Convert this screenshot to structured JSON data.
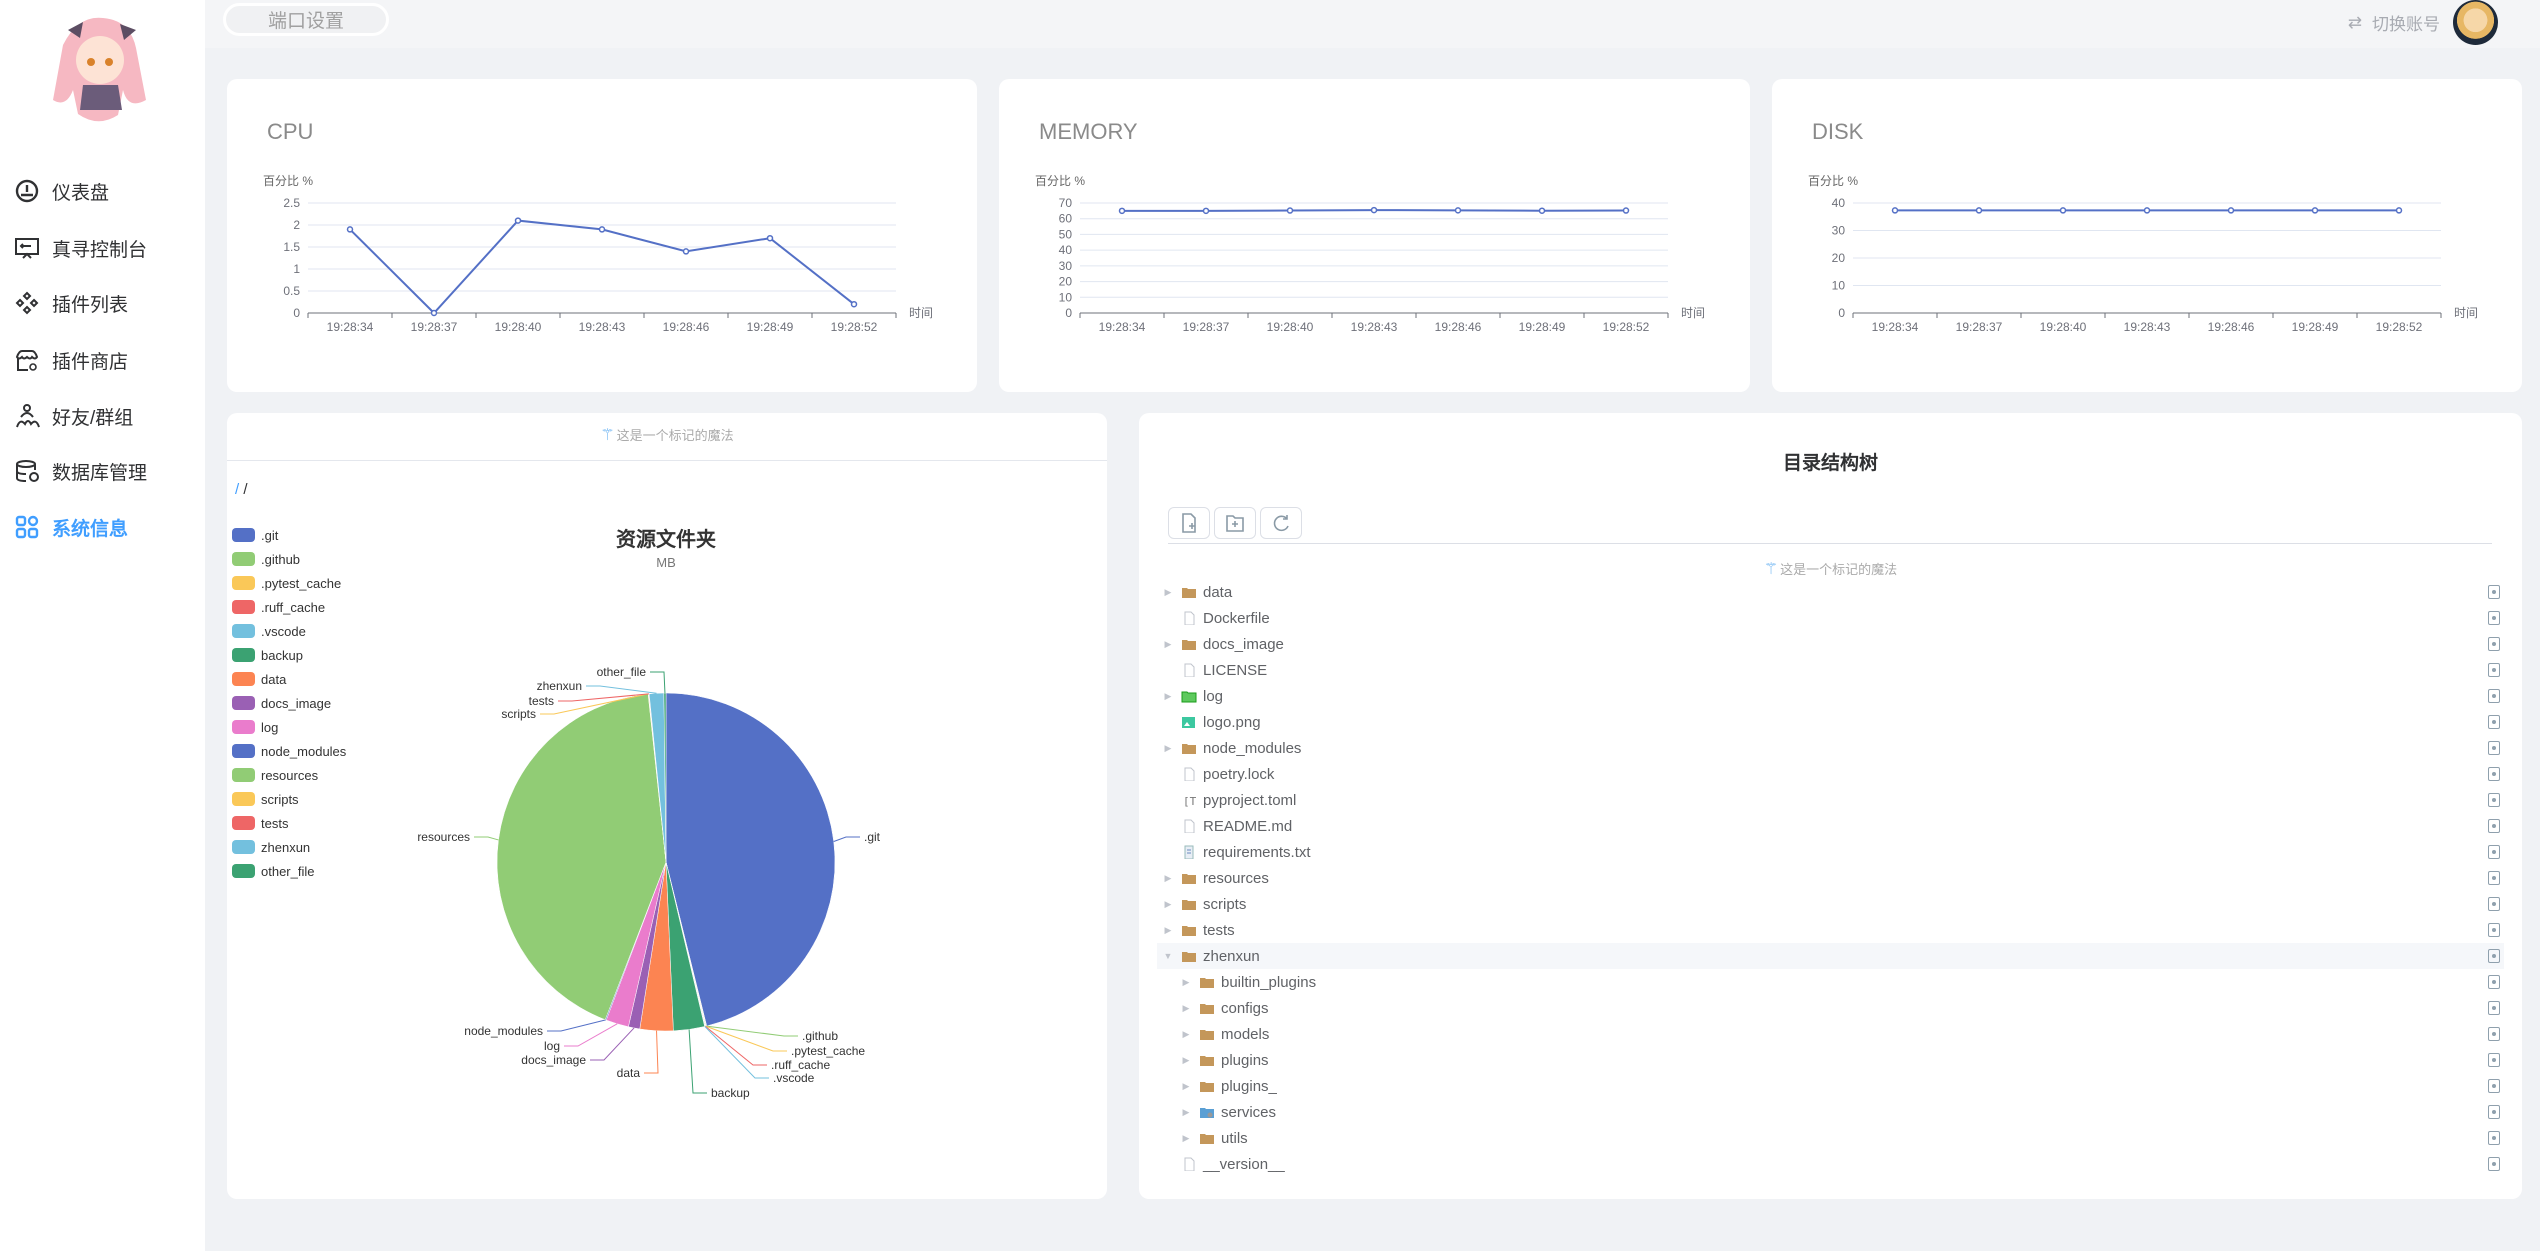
{
  "sidebar": {
    "items": [
      {
        "label": "仪表盘",
        "icon": "dashboard-icon",
        "active": false
      },
      {
        "label": "真寻控制台",
        "icon": "console-icon",
        "active": false
      },
      {
        "label": "插件列表",
        "icon": "plugins-icon",
        "active": false
      },
      {
        "label": "插件商店",
        "icon": "store-icon",
        "active": false
      },
      {
        "label": "好友/群组",
        "icon": "friends-icon",
        "active": false
      },
      {
        "label": "数据库管理",
        "icon": "database-icon",
        "active": false
      },
      {
        "label": "系统信息",
        "icon": "apps-icon",
        "active": true
      }
    ]
  },
  "header": {
    "port_button": "端口设置",
    "switch_account": "切换账号"
  },
  "colors": {
    "accent": "#409eff",
    "line": "#5470c6"
  },
  "chart_data": [
    {
      "type": "line",
      "title": "CPU",
      "ylabel": "百分比 %",
      "xlabel": "时间",
      "ylim": [
        0,
        2.5
      ],
      "yticks": [
        "0",
        "0.5",
        "1",
        "1.5",
        "2",
        "2.5"
      ],
      "categories": [
        "19:28:34",
        "19:28:37",
        "19:28:40",
        "19:28:43",
        "19:28:46",
        "19:28:49",
        "19:28:52"
      ],
      "values": [
        1.9,
        0,
        2.1,
        1.9,
        1.4,
        1.7,
        0.2
      ]
    },
    {
      "type": "line",
      "title": "MEMORY",
      "ylabel": "百分比 %",
      "xlabel": "时间",
      "ylim": [
        0,
        70
      ],
      "yticks": [
        "0",
        "10",
        "20",
        "30",
        "40",
        "50",
        "60",
        "70"
      ],
      "categories": [
        "19:28:34",
        "19:28:37",
        "19:28:40",
        "19:28:43",
        "19:28:46",
        "19:28:49",
        "19:28:52"
      ],
      "values": [
        65,
        65,
        65.2,
        65.5,
        65.3,
        65.1,
        65.2
      ]
    },
    {
      "type": "line",
      "title": "DISK",
      "ylabel": "百分比 %",
      "xlabel": "时间",
      "ylim": [
        0,
        40
      ],
      "yticks": [
        "0",
        "10",
        "20",
        "30",
        "40"
      ],
      "categories": [
        "19:28:34",
        "19:28:37",
        "19:28:40",
        "19:28:43",
        "19:28:46",
        "19:28:49",
        "19:28:52"
      ],
      "values": [
        37.3,
        37.3,
        37.3,
        37.3,
        37.3,
        37.3,
        37.3
      ]
    },
    {
      "type": "pie",
      "title": "资源文件夹",
      "subtitle": "MB",
      "legend": "left",
      "slices": [
        {
          "name": ".git",
          "value": 46.5,
          "color": "#5470c6"
        },
        {
          "name": ".github",
          "value": 0.05,
          "color": "#91cc75"
        },
        {
          "name": ".pytest_cache",
          "value": 0.05,
          "color": "#fac858"
        },
        {
          "name": ".ruff_cache",
          "value": 0.05,
          "color": "#ee6666"
        },
        {
          "name": ".vscode",
          "value": 0.05,
          "color": "#73c0de"
        },
        {
          "name": "backup",
          "value": 3.0,
          "color": "#3ba272"
        },
        {
          "name": "data",
          "value": 3.2,
          "color": "#fc8452"
        },
        {
          "name": "docs_image",
          "value": 1.1,
          "color": "#9a60b4"
        },
        {
          "name": "log",
          "value": 2.2,
          "color": "#ea7ccc"
        },
        {
          "name": "node_modules",
          "value": 0.1,
          "color": "#5470c6"
        },
        {
          "name": "resources",
          "value": 42.8,
          "color": "#91cc75"
        },
        {
          "name": "scripts",
          "value": 0.05,
          "color": "#fac858"
        },
        {
          "name": "tests",
          "value": 0.05,
          "color": "#ee6666"
        },
        {
          "name": "zhenxun",
          "value": 1.4,
          "color": "#73c0de"
        },
        {
          "name": "other_file",
          "value": 0.2,
          "color": "#3ba272"
        }
      ]
    }
  ],
  "resource_panel": {
    "magic_text": "这是一个标记的魔法",
    "breadcrumb_root": "/",
    "breadcrumb_current": "/"
  },
  "tree_panel": {
    "title": "目录结构树",
    "magic_text": "这是一个标记的魔法",
    "toolbar": [
      {
        "icon": "new-file-icon"
      },
      {
        "icon": "new-folder-icon"
      },
      {
        "icon": "refresh-icon"
      }
    ],
    "rows": [
      {
        "name": "data",
        "type": "folder",
        "depth": 0,
        "expandable": true
      },
      {
        "name": "Dockerfile",
        "type": "file",
        "depth": 0
      },
      {
        "name": "docs_image",
        "type": "folder",
        "depth": 0,
        "expandable": true
      },
      {
        "name": "LICENSE",
        "type": "file",
        "depth": 0
      },
      {
        "name": "log",
        "type": "log-folder",
        "depth": 0,
        "expandable": true
      },
      {
        "name": "logo.png",
        "type": "image",
        "depth": 0
      },
      {
        "name": "node_modules",
        "type": "folder",
        "depth": 0,
        "expandable": true
      },
      {
        "name": "poetry.lock",
        "type": "file",
        "depth": 0
      },
      {
        "name": "pyproject.toml",
        "type": "toml",
        "depth": 0
      },
      {
        "name": "README.md",
        "type": "file",
        "depth": 0
      },
      {
        "name": "requirements.txt",
        "type": "text",
        "depth": 0
      },
      {
        "name": "resources",
        "type": "folder",
        "depth": 0,
        "expandable": true
      },
      {
        "name": "scripts",
        "type": "folder",
        "depth": 0,
        "expandable": true
      },
      {
        "name": "tests",
        "type": "folder",
        "depth": 0,
        "expandable": true
      },
      {
        "name": "zhenxun",
        "type": "folder",
        "depth": 0,
        "expandable": true,
        "expanded": true,
        "highlighted": true
      },
      {
        "name": "builtin_plugins",
        "type": "folder",
        "depth": 1,
        "expandable": true
      },
      {
        "name": "configs",
        "type": "folder",
        "depth": 1,
        "expandable": true
      },
      {
        "name": "models",
        "type": "folder",
        "depth": 1,
        "expandable": true
      },
      {
        "name": "plugins",
        "type": "folder",
        "depth": 1,
        "expandable": true
      },
      {
        "name": "plugins_",
        "type": "folder",
        "depth": 1,
        "expandable": true
      },
      {
        "name": "services",
        "type": "service-folder",
        "depth": 1,
        "expandable": true
      },
      {
        "name": "utils",
        "type": "folder",
        "depth": 1,
        "expandable": true
      },
      {
        "name": "__version__",
        "type": "file",
        "depth": 0
      }
    ]
  }
}
